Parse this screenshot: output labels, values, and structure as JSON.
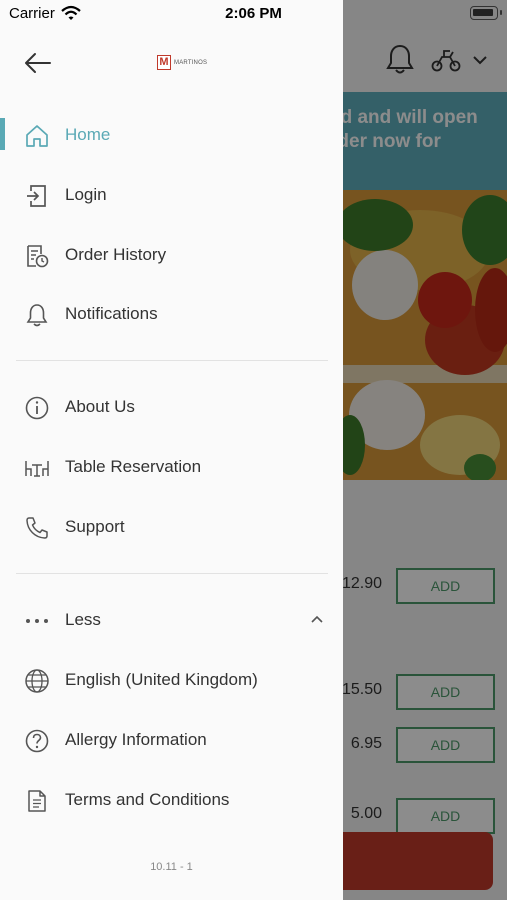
{
  "status_bar": {
    "carrier": "Carrier",
    "time": "2:06 PM"
  },
  "background": {
    "banner_text": "ed and will open rder now for",
    "prices": [
      "12.90",
      "15.50",
      "6.95",
      "5.00"
    ],
    "add_label": "ADD"
  },
  "drawer": {
    "logo_letter": "M",
    "logo_text": "MARTINOS",
    "menu": [
      {
        "label": "Home",
        "icon": "home-icon",
        "active": true
      },
      {
        "label": "Login",
        "icon": "login-icon",
        "active": false
      },
      {
        "label": "Order History",
        "icon": "order-history-icon",
        "active": false
      },
      {
        "label": "Notifications",
        "icon": "bell-icon",
        "active": false
      }
    ],
    "info": [
      {
        "label": "About Us",
        "icon": "info-icon"
      },
      {
        "label": "Table Reservation",
        "icon": "table-icon"
      },
      {
        "label": "Support",
        "icon": "phone-icon"
      }
    ],
    "more": {
      "label": "Less",
      "icon": "more-dots-icon"
    },
    "extra": [
      {
        "label": "English (United Kingdom)",
        "icon": "globe-icon"
      },
      {
        "label": "Allergy Information",
        "icon": "question-icon"
      },
      {
        "label": "Terms and Conditions",
        "icon": "document-icon"
      }
    ],
    "version": "10.11 - 1"
  },
  "colors": {
    "accent": "#5aa9b5",
    "add_green": "#4e9a6b",
    "banner": "#5fb0bd",
    "cta": "#c0392b"
  }
}
